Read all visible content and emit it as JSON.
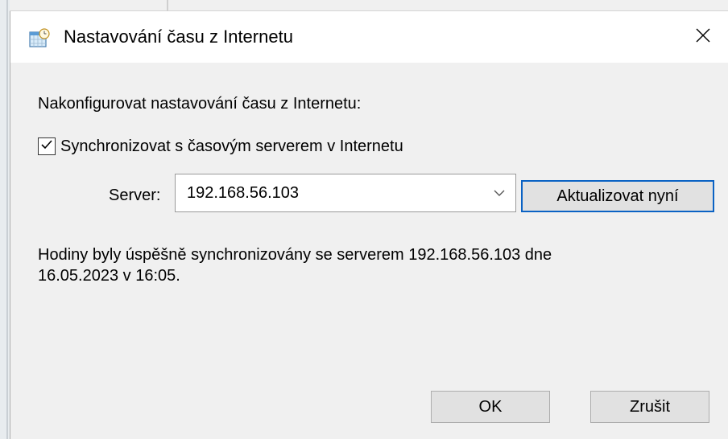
{
  "dialog": {
    "title": "Nastavování času z Internetu",
    "heading": "Nakonfigurovat nastavování času z Internetu:",
    "sync_checkbox": {
      "label": "Synchronizovat s časovým serverem v Internetu",
      "checked": true
    },
    "server_label": "Server:",
    "server_value": "192.168.56.103",
    "update_button": "Aktualizovat nyní",
    "status_line1": "Hodiny byly úspěšně synchronizovány se serverem 192.168.56.103 dne",
    "status_line2": "16.05.2023 v 16:05.",
    "ok_button": "OK",
    "cancel_button": "Zrušit"
  },
  "icons": {
    "title": "calendar-clock-icon",
    "close": "close-icon",
    "checkbox": "checkmark-icon",
    "combo": "chevron-down-icon"
  },
  "colors": {
    "dialog_bg": "#f0f0f0",
    "titlebar_bg": "#ffffff",
    "default_button_border": "#0a62c4",
    "button_bg": "#e1e1e1"
  }
}
